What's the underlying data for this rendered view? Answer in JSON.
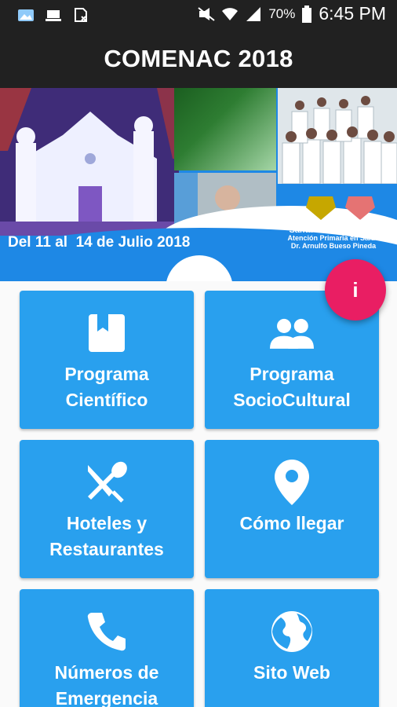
{
  "status_bar": {
    "battery": "70%",
    "time": "6:45 PM",
    "icons": [
      "gallery-icon",
      "download-icon",
      "sim-icon",
      "mute-icon",
      "wifi-icon",
      "signal-icon",
      "battery-icon"
    ]
  },
  "app_bar": {
    "title": "COMENAC 2018"
  },
  "banner": {
    "date": "Del 11 al  14 de Julio 2018",
    "line1": "LXI Congreso Médico Nacional",
    "line2": "Santa Rosa de Copán",
    "line3": "Atención Primaria en Salud",
    "line4": "Dr. Arnulfo Bueso Pineda"
  },
  "fab": {
    "label": "i",
    "color": "#e91e63"
  },
  "colors": {
    "tile": "#29a0ee",
    "banner": "#1e88e5",
    "bar": "#212121"
  },
  "tiles": [
    {
      "icon": "book-icon",
      "line1": "Programa",
      "line2": "Científico"
    },
    {
      "icon": "people-icon",
      "line1": "Programa",
      "line2": "SocioCultural"
    },
    {
      "icon": "restaurant-icon",
      "line1": "Hoteles y",
      "line2": "Restaurantes"
    },
    {
      "icon": "location-pin-icon",
      "line1": "Cómo llegar",
      "line2": ""
    },
    {
      "icon": "phone-icon",
      "line1": "Números de",
      "line2": "Emergencia"
    },
    {
      "icon": "globe-icon",
      "line1": "Sito Web",
      "line2": ""
    }
  ]
}
